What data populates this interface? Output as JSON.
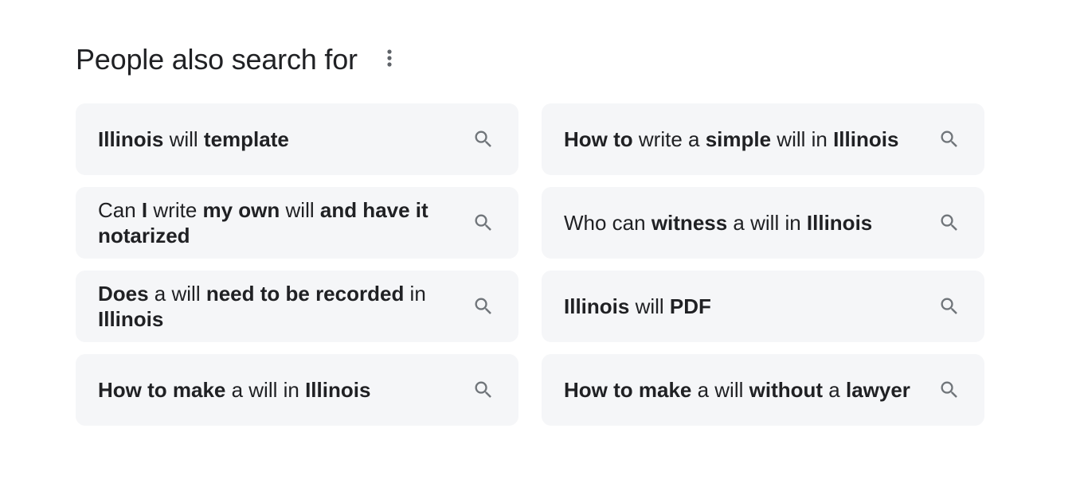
{
  "header": {
    "title": "People also search for",
    "more_icon": "more-vert-icon"
  },
  "icons": {
    "search": "search-icon"
  },
  "colors": {
    "chip_bg": "#f5f6f8",
    "text": "#202124",
    "icon": "#70757a"
  },
  "suggestions": [
    {
      "segments": [
        {
          "t": "Illinois",
          "b": true
        },
        {
          "t": " will ",
          "b": false
        },
        {
          "t": "template",
          "b": true
        }
      ]
    },
    {
      "segments": [
        {
          "t": "How to",
          "b": true
        },
        {
          "t": " write a ",
          "b": false
        },
        {
          "t": "simple",
          "b": true
        },
        {
          "t": " will in ",
          "b": false
        },
        {
          "t": "Illinois",
          "b": true
        }
      ]
    },
    {
      "segments": [
        {
          "t": "Can ",
          "b": false
        },
        {
          "t": "I",
          "b": true
        },
        {
          "t": " write ",
          "b": false
        },
        {
          "t": "my own",
          "b": true
        },
        {
          "t": " will ",
          "b": false
        },
        {
          "t": "and have it notarized",
          "b": true
        }
      ]
    },
    {
      "segments": [
        {
          "t": "Who can ",
          "b": false
        },
        {
          "t": "witness",
          "b": true
        },
        {
          "t": " a will in ",
          "b": false
        },
        {
          "t": "Illinois",
          "b": true
        }
      ]
    },
    {
      "segments": [
        {
          "t": "Does",
          "b": true
        },
        {
          "t": " a will ",
          "b": false
        },
        {
          "t": "need to be recorded",
          "b": true
        },
        {
          "t": " in ",
          "b": false
        },
        {
          "t": "Illinois",
          "b": true
        }
      ]
    },
    {
      "segments": [
        {
          "t": "Illinois",
          "b": true
        },
        {
          "t": " will ",
          "b": false
        },
        {
          "t": "PDF",
          "b": true
        }
      ]
    },
    {
      "segments": [
        {
          "t": "How to make",
          "b": true
        },
        {
          "t": " a will in ",
          "b": false
        },
        {
          "t": "Illinois",
          "b": true
        }
      ]
    },
    {
      "segments": [
        {
          "t": "How to make",
          "b": true
        },
        {
          "t": " a will ",
          "b": false
        },
        {
          "t": "without",
          "b": true
        },
        {
          "t": " a ",
          "b": false
        },
        {
          "t": "lawyer",
          "b": true
        }
      ]
    }
  ]
}
